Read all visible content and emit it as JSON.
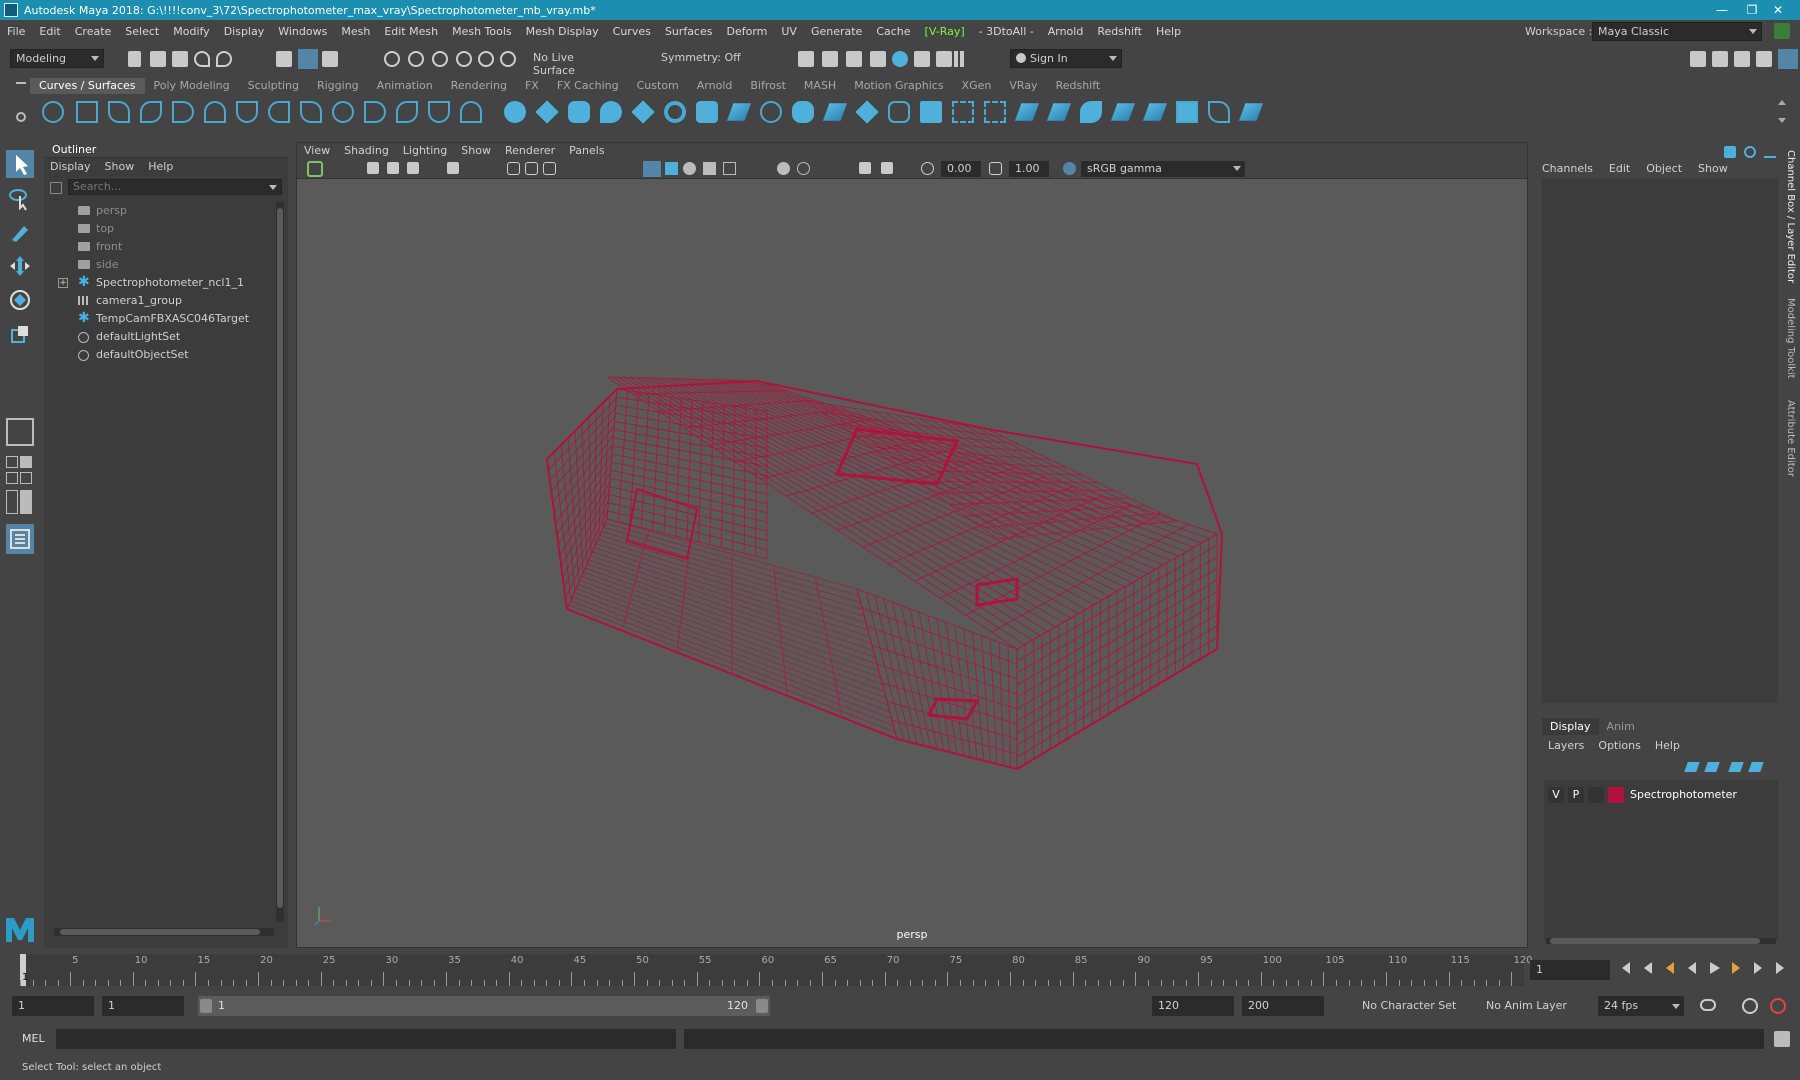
{
  "window": {
    "title": "Autodesk Maya 2018: G:\\!!!!conv_3\\72\\Spectrophotometer_max_vray\\Spectrophotometer_mb_vray.mb*",
    "controls": {
      "minimize": "—",
      "maximize": "❐",
      "close": "✕"
    }
  },
  "menubar": {
    "items": [
      "File",
      "Edit",
      "Create",
      "Select",
      "Modify",
      "Display",
      "Windows",
      "Mesh",
      "Edit Mesh",
      "Mesh Tools",
      "Mesh Display",
      "Curves",
      "Surfaces",
      "Deform",
      "UV",
      "Generate",
      "Cache",
      "[V-Ray]",
      "- 3DtoAll -",
      "Arnold",
      "Redshift",
      "Help"
    ],
    "workspace_label": "Workspace :",
    "workspace_value": "Maya Classic"
  },
  "statusline": {
    "mode": "Modeling",
    "live_surface": "No Live Surface",
    "symmetry": "Symmetry: Off",
    "sign_in": "Sign In"
  },
  "shelf": {
    "tabs": [
      "Curves / Surfaces",
      "Poly Modeling",
      "Sculpting",
      "Rigging",
      "Animation",
      "Rendering",
      "FX",
      "FX Caching",
      "Custom",
      "Arnold",
      "Bifrost",
      "MASH",
      "Motion Graphics",
      "XGen",
      "VRay",
      "Redshift"
    ],
    "active_tab": "Curves / Surfaces"
  },
  "outliner": {
    "title": "Outliner",
    "menu": [
      "Display",
      "Show",
      "Help"
    ],
    "search_placeholder": "Search...",
    "items": [
      {
        "label": "persp",
        "icon": "camera-icon",
        "dim": true
      },
      {
        "label": "top",
        "icon": "camera-icon",
        "dim": true
      },
      {
        "label": "front",
        "icon": "camera-icon",
        "dim": true
      },
      {
        "label": "side",
        "icon": "camera-icon",
        "dim": true
      },
      {
        "label": "Spectrophotometer_ncl1_1",
        "icon": "locator-icon",
        "dim": false,
        "expandable": true
      },
      {
        "label": "camera1_group",
        "icon": "group-icon",
        "dim": false
      },
      {
        "label": "TempCamFBXASC046Target",
        "icon": "locator-icon",
        "dim": false
      },
      {
        "label": "defaultLightSet",
        "icon": "set-icon",
        "dim": false
      },
      {
        "label": "defaultObjectSet",
        "icon": "set-icon",
        "dim": false
      }
    ]
  },
  "viewport": {
    "menu": [
      "View",
      "Shading",
      "Lighting",
      "Show",
      "Renderer",
      "Panels"
    ],
    "exposure": "0.00",
    "gamma": "1.00",
    "color_space": "sRGB gamma",
    "camera_label": "persp",
    "wireframe_color": "#b0123a"
  },
  "channelbox": {
    "menu": [
      "Channels",
      "Edit",
      "Object",
      "Show"
    ],
    "side_tabs": [
      "Channel Box / Layer Editor",
      "Modeling Toolkit",
      "Attribute Editor"
    ]
  },
  "layers": {
    "tabs": [
      "Display",
      "Anim"
    ],
    "active_tab": "Display",
    "menu": [
      "Layers",
      "Options",
      "Help"
    ],
    "rows": [
      {
        "v": "V",
        "p": "P",
        "color": "#b0123a",
        "name": "Spectrophotometer"
      }
    ]
  },
  "timeline": {
    "ticks": [
      5,
      10,
      15,
      20,
      25,
      30,
      35,
      40,
      45,
      50,
      55,
      60,
      65,
      70,
      75,
      80,
      85,
      90,
      95,
      100,
      105,
      110,
      115,
      120
    ],
    "current_frame_marker": "1",
    "current_frame": "1"
  },
  "range": {
    "start": "1",
    "playback_start": "1",
    "slider_start": "1",
    "slider_end": "120",
    "playback_end": "120",
    "end": "200",
    "character_set": "No Character Set",
    "anim_layer": "No Anim Layer",
    "fps": "24 fps"
  },
  "command": {
    "label": "MEL"
  },
  "help_line": "Select Tool: select an object"
}
